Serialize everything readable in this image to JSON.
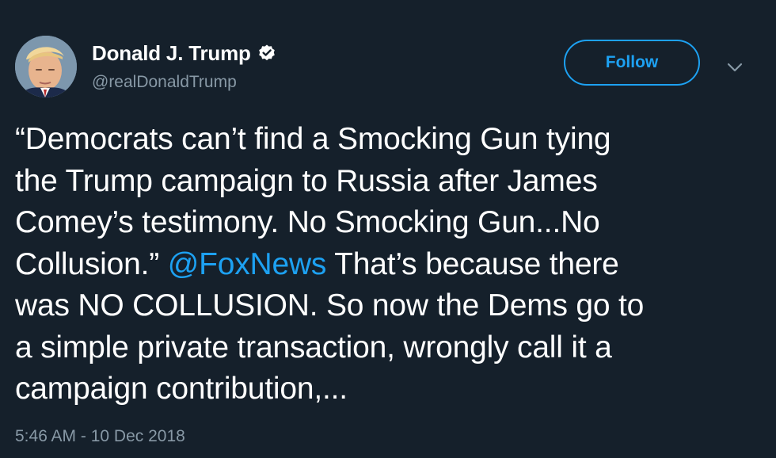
{
  "user": {
    "display_name": "Donald J. Trump",
    "handle": "@realDonaldTrump",
    "verified": true
  },
  "follow_button": {
    "label": "Follow"
  },
  "tweet": {
    "text_before_mention": "“Democrats can’t find a Smocking Gun tying\nthe Trump campaign to Russia after James\nComey’s testimony. No Smocking Gun...No\nCollusion.” ",
    "mention": "@FoxNews",
    "text_after_mention": "  That’s because there\nwas NO COLLUSION. So now the Dems go to\na simple private transaction, wrongly call it a\ncampaign contribution,...",
    "timestamp": "5:46 AM - 10 Dec 2018"
  },
  "icons": {
    "verified": "verified-badge-icon",
    "caret": "chevron-down-icon"
  },
  "colors": {
    "background": "#15202b",
    "accent": "#1da1f2",
    "text": "#ffffff",
    "muted": "#8899a6"
  }
}
